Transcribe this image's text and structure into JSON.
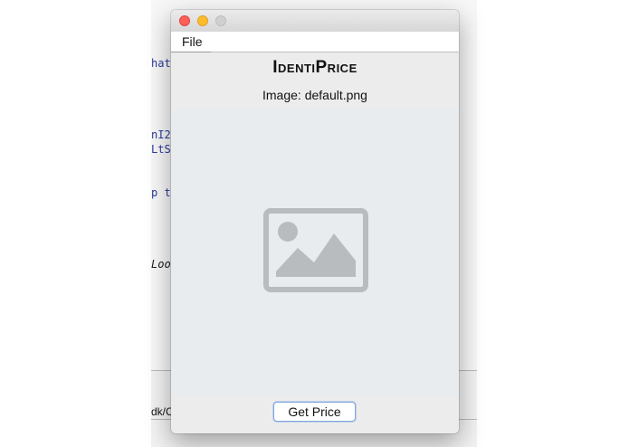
{
  "background_editor": {
    "code_fragments": [
      "hat",
      "nI2",
      "LtS",
      "p t",
      "Loo"
    ],
    "path_fragment": "dk/C"
  },
  "window": {
    "controls": {
      "close_icon": "close-dot-icon",
      "minimize_icon": "minimize-dot-icon",
      "zoom_icon": "zoom-dot-icon"
    },
    "colors": {
      "close": "#fc5f57",
      "minimize": "#fdbc2e",
      "zoom": "#d0d0d0"
    }
  },
  "menu": {
    "items": [
      {
        "label": "File"
      }
    ]
  },
  "app": {
    "title": "IdentiPrice",
    "image_label": "Image: default.png",
    "image_placeholder_icon": "image-placeholder-icon",
    "image_area_color": "#e9ecee",
    "get_price_label": "Get Price",
    "button_focus_color": "#7fa6e0"
  }
}
